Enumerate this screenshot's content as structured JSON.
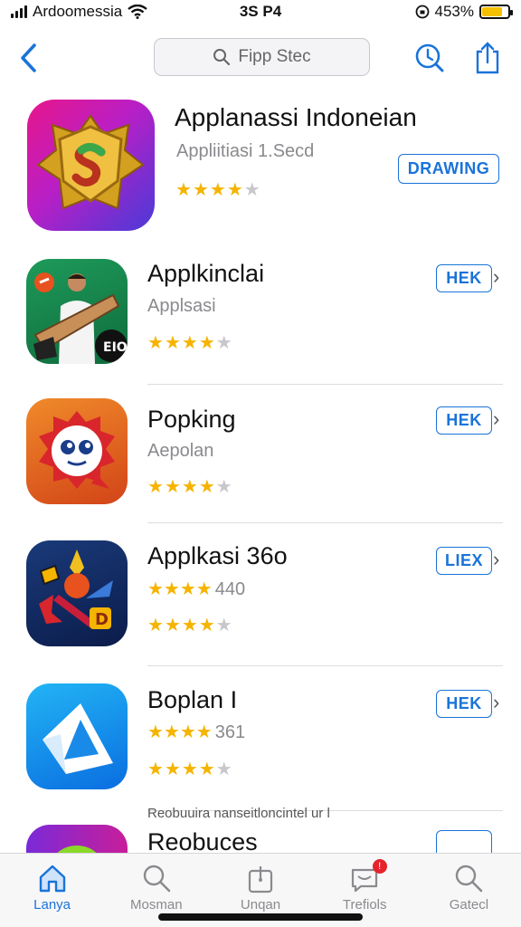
{
  "status_bar": {
    "carrier": "Ardoomessia",
    "time": "3S P4",
    "battery_percent": "453%",
    "battery_level": 0.8
  },
  "nav": {
    "search_placeholder": "Fipp Stec"
  },
  "featured": {
    "title": "Applanassi Indoneian",
    "subtitle": "Appliitiasi 1.Secd",
    "rating": 4,
    "button_label": "DRAWING"
  },
  "apps": [
    {
      "title": "Applkinclai",
      "subtitle": "Applsasi",
      "rating_text": "",
      "rating": 4,
      "button_label": "HEK"
    },
    {
      "title": "Popking",
      "subtitle": "Aepolan",
      "rating_text": "",
      "rating": 4,
      "button_label": "HEK"
    },
    {
      "title": "Applkasi 36o",
      "subtitle": "",
      "rating_text": "440",
      "rating": 4,
      "button_label": "LIEX"
    },
    {
      "title": "Boplan I",
      "subtitle": "",
      "rating_text": "361",
      "rating": 4,
      "button_label": "HEK"
    },
    {
      "title": "Reobuces",
      "subtitle": "",
      "rating_text": "",
      "rating": 0,
      "button_label": ""
    }
  ],
  "notice": "Reobuuira nanseitloncintel ur l",
  "tabs": [
    {
      "label": "Lanya",
      "icon": "home-icon",
      "active": true
    },
    {
      "label": "Mosman",
      "icon": "search-icon",
      "active": false
    },
    {
      "label": "Unqan",
      "icon": "bag-icon",
      "active": false
    },
    {
      "label": "Trefiols",
      "icon": "chat-icon",
      "active": false,
      "badge": "!"
    },
    {
      "label": "Gatecl",
      "icon": "search-icon",
      "active": false
    }
  ],
  "colors": {
    "accent": "#1a73d9",
    "star": "#f5b400",
    "badge": "#e5242b"
  }
}
